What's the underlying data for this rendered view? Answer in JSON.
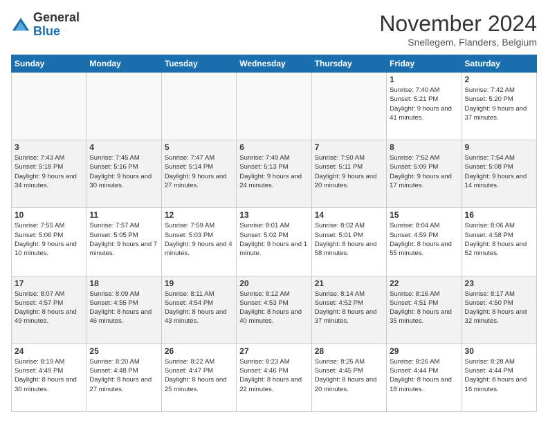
{
  "logo": {
    "general": "General",
    "blue": "Blue"
  },
  "header": {
    "month": "November 2024",
    "location": "Snellegem, Flanders, Belgium"
  },
  "weekdays": [
    "Sunday",
    "Monday",
    "Tuesday",
    "Wednesday",
    "Thursday",
    "Friday",
    "Saturday"
  ],
  "weeks": [
    [
      {
        "day": "",
        "info": ""
      },
      {
        "day": "",
        "info": ""
      },
      {
        "day": "",
        "info": ""
      },
      {
        "day": "",
        "info": ""
      },
      {
        "day": "",
        "info": ""
      },
      {
        "day": "1",
        "info": "Sunrise: 7:40 AM\nSunset: 5:21 PM\nDaylight: 9 hours and 41 minutes."
      },
      {
        "day": "2",
        "info": "Sunrise: 7:42 AM\nSunset: 5:20 PM\nDaylight: 9 hours and 37 minutes."
      }
    ],
    [
      {
        "day": "3",
        "info": "Sunrise: 7:43 AM\nSunset: 5:18 PM\nDaylight: 9 hours and 34 minutes."
      },
      {
        "day": "4",
        "info": "Sunrise: 7:45 AM\nSunset: 5:16 PM\nDaylight: 9 hours and 30 minutes."
      },
      {
        "day": "5",
        "info": "Sunrise: 7:47 AM\nSunset: 5:14 PM\nDaylight: 9 hours and 27 minutes."
      },
      {
        "day": "6",
        "info": "Sunrise: 7:49 AM\nSunset: 5:13 PM\nDaylight: 9 hours and 24 minutes."
      },
      {
        "day": "7",
        "info": "Sunrise: 7:50 AM\nSunset: 5:11 PM\nDaylight: 9 hours and 20 minutes."
      },
      {
        "day": "8",
        "info": "Sunrise: 7:52 AM\nSunset: 5:09 PM\nDaylight: 9 hours and 17 minutes."
      },
      {
        "day": "9",
        "info": "Sunrise: 7:54 AM\nSunset: 5:08 PM\nDaylight: 9 hours and 14 minutes."
      }
    ],
    [
      {
        "day": "10",
        "info": "Sunrise: 7:55 AM\nSunset: 5:06 PM\nDaylight: 9 hours and 10 minutes."
      },
      {
        "day": "11",
        "info": "Sunrise: 7:57 AM\nSunset: 5:05 PM\nDaylight: 9 hours and 7 minutes."
      },
      {
        "day": "12",
        "info": "Sunrise: 7:59 AM\nSunset: 5:03 PM\nDaylight: 9 hours and 4 minutes."
      },
      {
        "day": "13",
        "info": "Sunrise: 8:01 AM\nSunset: 5:02 PM\nDaylight: 9 hours and 1 minute."
      },
      {
        "day": "14",
        "info": "Sunrise: 8:02 AM\nSunset: 5:01 PM\nDaylight: 8 hours and 58 minutes."
      },
      {
        "day": "15",
        "info": "Sunrise: 8:04 AM\nSunset: 4:59 PM\nDaylight: 8 hours and 55 minutes."
      },
      {
        "day": "16",
        "info": "Sunrise: 8:06 AM\nSunset: 4:58 PM\nDaylight: 8 hours and 52 minutes."
      }
    ],
    [
      {
        "day": "17",
        "info": "Sunrise: 8:07 AM\nSunset: 4:57 PM\nDaylight: 8 hours and 49 minutes."
      },
      {
        "day": "18",
        "info": "Sunrise: 8:09 AM\nSunset: 4:55 PM\nDaylight: 8 hours and 46 minutes."
      },
      {
        "day": "19",
        "info": "Sunrise: 8:11 AM\nSunset: 4:54 PM\nDaylight: 8 hours and 43 minutes."
      },
      {
        "day": "20",
        "info": "Sunrise: 8:12 AM\nSunset: 4:53 PM\nDaylight: 8 hours and 40 minutes."
      },
      {
        "day": "21",
        "info": "Sunrise: 8:14 AM\nSunset: 4:52 PM\nDaylight: 8 hours and 37 minutes."
      },
      {
        "day": "22",
        "info": "Sunrise: 8:16 AM\nSunset: 4:51 PM\nDaylight: 8 hours and 35 minutes."
      },
      {
        "day": "23",
        "info": "Sunrise: 8:17 AM\nSunset: 4:50 PM\nDaylight: 8 hours and 32 minutes."
      }
    ],
    [
      {
        "day": "24",
        "info": "Sunrise: 8:19 AM\nSunset: 4:49 PM\nDaylight: 8 hours and 30 minutes."
      },
      {
        "day": "25",
        "info": "Sunrise: 8:20 AM\nSunset: 4:48 PM\nDaylight: 8 hours and 27 minutes."
      },
      {
        "day": "26",
        "info": "Sunrise: 8:22 AM\nSunset: 4:47 PM\nDaylight: 8 hours and 25 minutes."
      },
      {
        "day": "27",
        "info": "Sunrise: 8:23 AM\nSunset: 4:46 PM\nDaylight: 8 hours and 22 minutes."
      },
      {
        "day": "28",
        "info": "Sunrise: 8:25 AM\nSunset: 4:45 PM\nDaylight: 8 hours and 20 minutes."
      },
      {
        "day": "29",
        "info": "Sunrise: 8:26 AM\nSunset: 4:44 PM\nDaylight: 8 hours and 18 minutes."
      },
      {
        "day": "30",
        "info": "Sunrise: 8:28 AM\nSunset: 4:44 PM\nDaylight: 8 hours and 16 minutes."
      }
    ]
  ]
}
